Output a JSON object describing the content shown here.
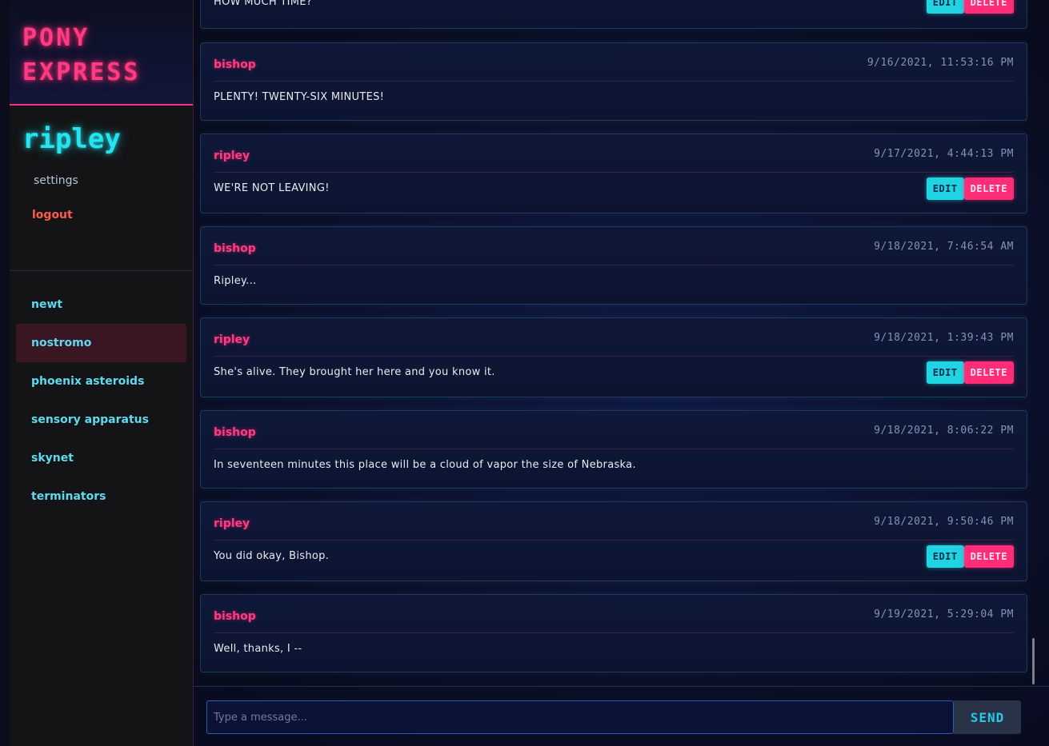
{
  "app": {
    "title": "PONY EXPRESS"
  },
  "user": {
    "name": "ripley",
    "settings_label": "settings",
    "logout_label": "logout"
  },
  "channels": [
    {
      "name": "newt",
      "active": false
    },
    {
      "name": "nostromo",
      "active": true
    },
    {
      "name": "phoenix asteroids",
      "active": false
    },
    {
      "name": "sensory apparatus",
      "active": false
    },
    {
      "name": "skynet",
      "active": false
    },
    {
      "name": "terminators",
      "active": false
    }
  ],
  "messages": [
    {
      "author": "",
      "timestamp": "",
      "body": "HOW MUCH TIME?",
      "own": true
    },
    {
      "author": "bishop",
      "timestamp": "9/16/2021, 11:53:16 PM",
      "body": "PLENTY!  TWENTY-SIX MINUTES!",
      "own": false
    },
    {
      "author": "ripley",
      "timestamp": "9/17/2021, 4:44:13 PM",
      "body": "WE'RE NOT LEAVING!",
      "own": true
    },
    {
      "author": "bishop",
      "timestamp": "9/18/2021, 7:46:54 AM",
      "body": "Ripley...",
      "own": false
    },
    {
      "author": "ripley",
      "timestamp": "9/18/2021, 1:39:43 PM",
      "body": "She's alive.  They brought her here and you know it.",
      "own": true
    },
    {
      "author": "bishop",
      "timestamp": "9/18/2021, 8:06:22 PM",
      "body": "In seventeen minutes this place will be a cloud of vapor the size of Nebraska.",
      "own": false
    },
    {
      "author": "ripley",
      "timestamp": "9/18/2021, 9:50:46 PM",
      "body": "You did okay, Bishop.",
      "own": true
    },
    {
      "author": "bishop",
      "timestamp": "9/19/2021, 5:29:04 PM",
      "body": "Well, thanks, I --",
      "own": false
    }
  ],
  "actions": {
    "edit_label": "EDIT",
    "delete_label": "DELETE"
  },
  "composer": {
    "placeholder": "Type a message...",
    "value": "",
    "send_label": "SEND"
  },
  "colors": {
    "accent_pink": "#ff2d78",
    "accent_cyan": "#25e4ee",
    "logout": "#ff5a4e"
  }
}
